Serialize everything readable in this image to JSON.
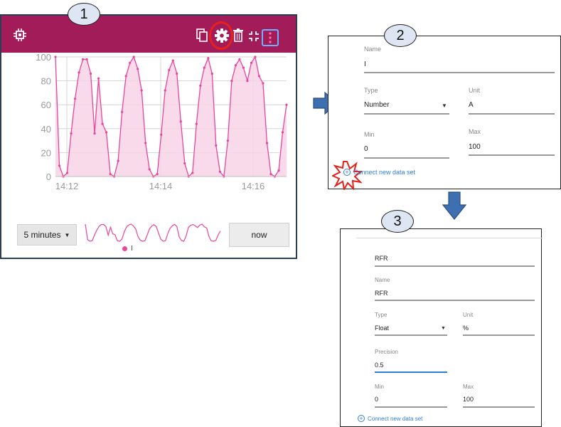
{
  "steps": [
    "1",
    "2",
    "3"
  ],
  "panel1": {
    "toolbar": {
      "copy_icon": "copy-icon",
      "settings_icon": "gear-icon",
      "delete_icon": "trash-icon",
      "collapse_icon": "collapse-icon",
      "more_icon": "more-vert-icon"
    },
    "time_range": "5 minutes",
    "now_label": "now",
    "legend_label": "I",
    "accent": "#a31c5a",
    "series_color": "#e8459b"
  },
  "chart_data": {
    "type": "area",
    "xlabels": [
      "14:12",
      "14:14",
      "14:16"
    ],
    "yticks": [
      "100",
      "80",
      "60",
      "40",
      "20",
      "0"
    ],
    "ylim": [
      0,
      100
    ],
    "series": [
      {
        "name": "I",
        "values": [
          100,
          9,
          0,
          3,
          36,
          65,
          87,
          98,
          98,
          86,
          36,
          82,
          44,
          37,
          2,
          0,
          13,
          54,
          84,
          95,
          100,
          90,
          72,
          28,
          6,
          0,
          2,
          35,
          72,
          89,
          97,
          86,
          46,
          11,
          0,
          3,
          44,
          76,
          91,
          99,
          86,
          26,
          4,
          0,
          30,
          80,
          93,
          98,
          91,
          80,
          95,
          100,
          84,
          78,
          28,
          2,
          0,
          5,
          37,
          60
        ]
      }
    ]
  },
  "panel2": {
    "name_label": "Name",
    "name_value": "I",
    "type_label": "Type",
    "type_value": "Number",
    "unit_label": "Unit",
    "unit_value": "A",
    "min_label": "Min",
    "min_value": "0",
    "max_label": "Max",
    "max_value": "100",
    "connect_label": "Connect new data set"
  },
  "panel3": {
    "top_value": "RFR",
    "name_label": "Name",
    "name_value": "RFR",
    "type_label": "Type",
    "type_value": "Float",
    "unit_label": "Unit",
    "unit_value": "%",
    "precision_label": "Precision",
    "precision_value": "0.5",
    "min_label": "Min",
    "min_value": "0",
    "max_label": "Max",
    "max_value": "100",
    "connect_label": "Connect new data set"
  }
}
